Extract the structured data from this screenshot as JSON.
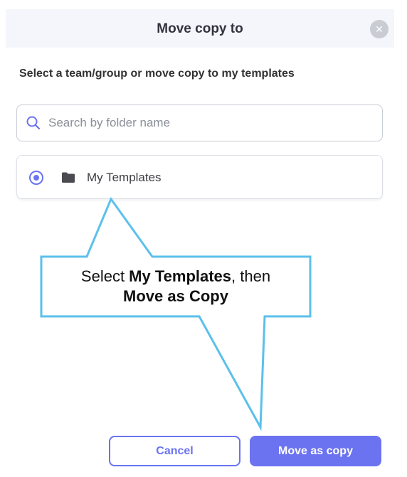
{
  "dialog": {
    "title": "Move copy to",
    "close_icon": "close-icon",
    "subtitle": "Select a team/group or move copy to my templates"
  },
  "search": {
    "placeholder": "Search by folder name",
    "value": "",
    "icon": "search-icon"
  },
  "folders": [
    {
      "label": "My Templates",
      "selected": true,
      "icon": "folder-icon"
    }
  ],
  "callout": {
    "prefix": "Select ",
    "target": "My Templates",
    "middle": ", then",
    "action": "Move as Copy",
    "border_color": "#5bc0eb"
  },
  "buttons": {
    "cancel": "Cancel",
    "move": "Move as copy"
  },
  "colors": {
    "accent": "#6a73f0",
    "header_bg": "#f4f6fb"
  }
}
